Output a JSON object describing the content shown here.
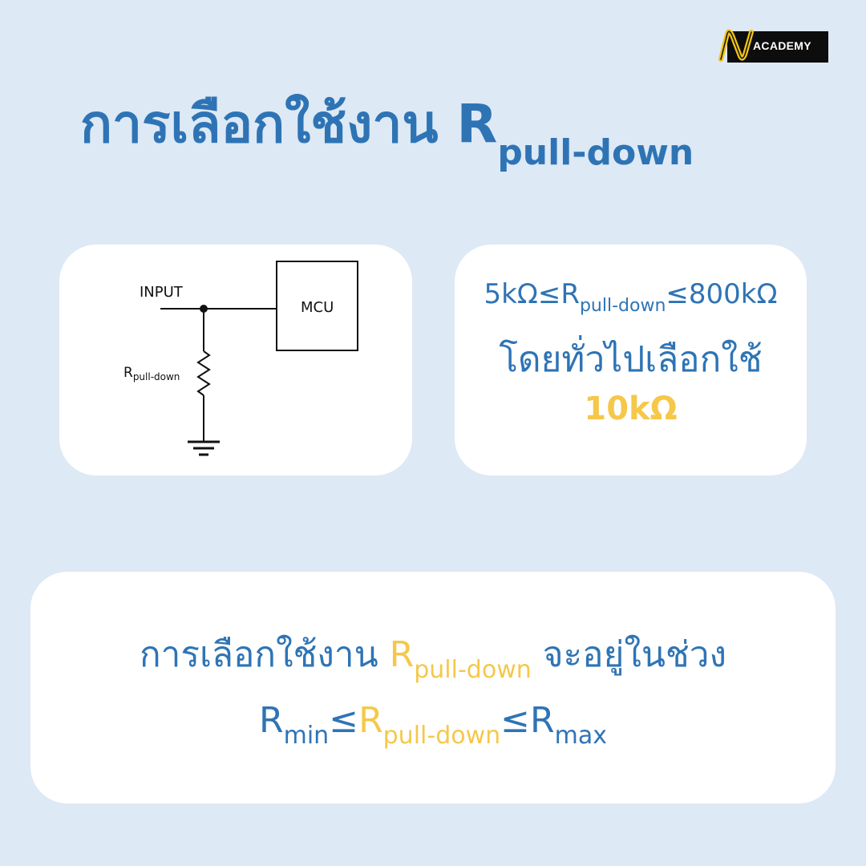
{
  "logo": {
    "text": "ACADEMY"
  },
  "title": {
    "main": "การเลือกใช้งาน R",
    "sub": "pull-down"
  },
  "circuit": {
    "input_label": "INPUT",
    "mcu_label": "MCU",
    "resistor_label_main": "R",
    "resistor_label_sub": "pull-down"
  },
  "range_card": {
    "min": "5kΩ≤R",
    "sub": "pull-down",
    "max": "≤800kΩ",
    "typical_text": "โดยทั่วไปเลือกใช้",
    "typical_value": "10kΩ"
  },
  "bottom_card": {
    "line1_before": "การเลือกใช้งาน ",
    "line1_r": "R",
    "line1_sub": "pull-down",
    "line1_after": " จะอยู่ในช่วง",
    "rmin": "R",
    "rmin_sub": "min",
    "leq1": "≤",
    "rpd": "R",
    "rpd_sub": "pull-down",
    "leq2": "≤",
    "rmax": "R",
    "rmax_sub": "max"
  },
  "colors": {
    "background": "#dde9f5",
    "primary": "#2e74b5",
    "highlight": "#f5c84a",
    "card": "#ffffff"
  }
}
